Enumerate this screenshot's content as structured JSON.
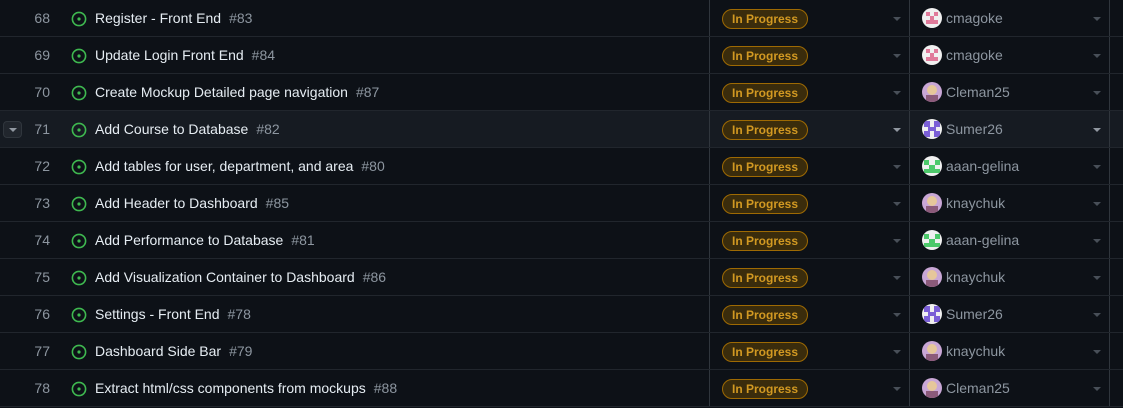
{
  "rows": [
    {
      "num": "68",
      "title": "Register - Front End",
      "issue": "#83",
      "status": "In Progress",
      "assignee": "cmagoke",
      "avatar": "pink-identicon",
      "hover": false
    },
    {
      "num": "69",
      "title": "Update Login Front End",
      "issue": "#84",
      "status": "In Progress",
      "assignee": "cmagoke",
      "avatar": "pink-identicon",
      "hover": false
    },
    {
      "num": "70",
      "title": "Create Mockup Detailed page navigation",
      "issue": "#87",
      "status": "In Progress",
      "assignee": "Cleman25",
      "avatar": "photo-avatar",
      "hover": false
    },
    {
      "num": "71",
      "title": "Add Course to Database",
      "issue": "#82",
      "status": "In Progress",
      "assignee": "Sumer26",
      "avatar": "purple-identicon",
      "hover": true
    },
    {
      "num": "72",
      "title": "Add tables for user, department, and area",
      "issue": "#80",
      "status": "In Progress",
      "assignee": "aaan-gelina",
      "avatar": "green-identicon",
      "hover": false
    },
    {
      "num": "73",
      "title": "Add Header to Dashboard",
      "issue": "#85",
      "status": "In Progress",
      "assignee": "knaychuk",
      "avatar": "photo-avatar",
      "hover": false
    },
    {
      "num": "74",
      "title": "Add Performance to Database",
      "issue": "#81",
      "status": "In Progress",
      "assignee": "aaan-gelina",
      "avatar": "green-identicon",
      "hover": false
    },
    {
      "num": "75",
      "title": "Add Visualization Container to Dashboard",
      "issue": "#86",
      "status": "In Progress",
      "assignee": "knaychuk",
      "avatar": "photo-avatar",
      "hover": false
    },
    {
      "num": "76",
      "title": "Settings - Front End",
      "issue": "#78",
      "status": "In Progress",
      "assignee": "Sumer26",
      "avatar": "purple-identicon",
      "hover": false
    },
    {
      "num": "77",
      "title": "Dashboard Side Bar",
      "issue": "#79",
      "status": "In Progress",
      "assignee": "knaychuk",
      "avatar": "photo-avatar",
      "hover": false
    },
    {
      "num": "78",
      "title": "Extract html/css components from mockups",
      "issue": "#88",
      "status": "In Progress",
      "assignee": "Cleman25",
      "avatar": "photo-avatar",
      "hover": false
    }
  ],
  "colors": {
    "open_issue": "#3fb950",
    "status_text": "#d29922",
    "status_bg": "#3a2c0c",
    "background": "#0d1117"
  },
  "icons": {
    "status": "issue-opened-icon",
    "dropdown": "chevron-down-icon"
  }
}
